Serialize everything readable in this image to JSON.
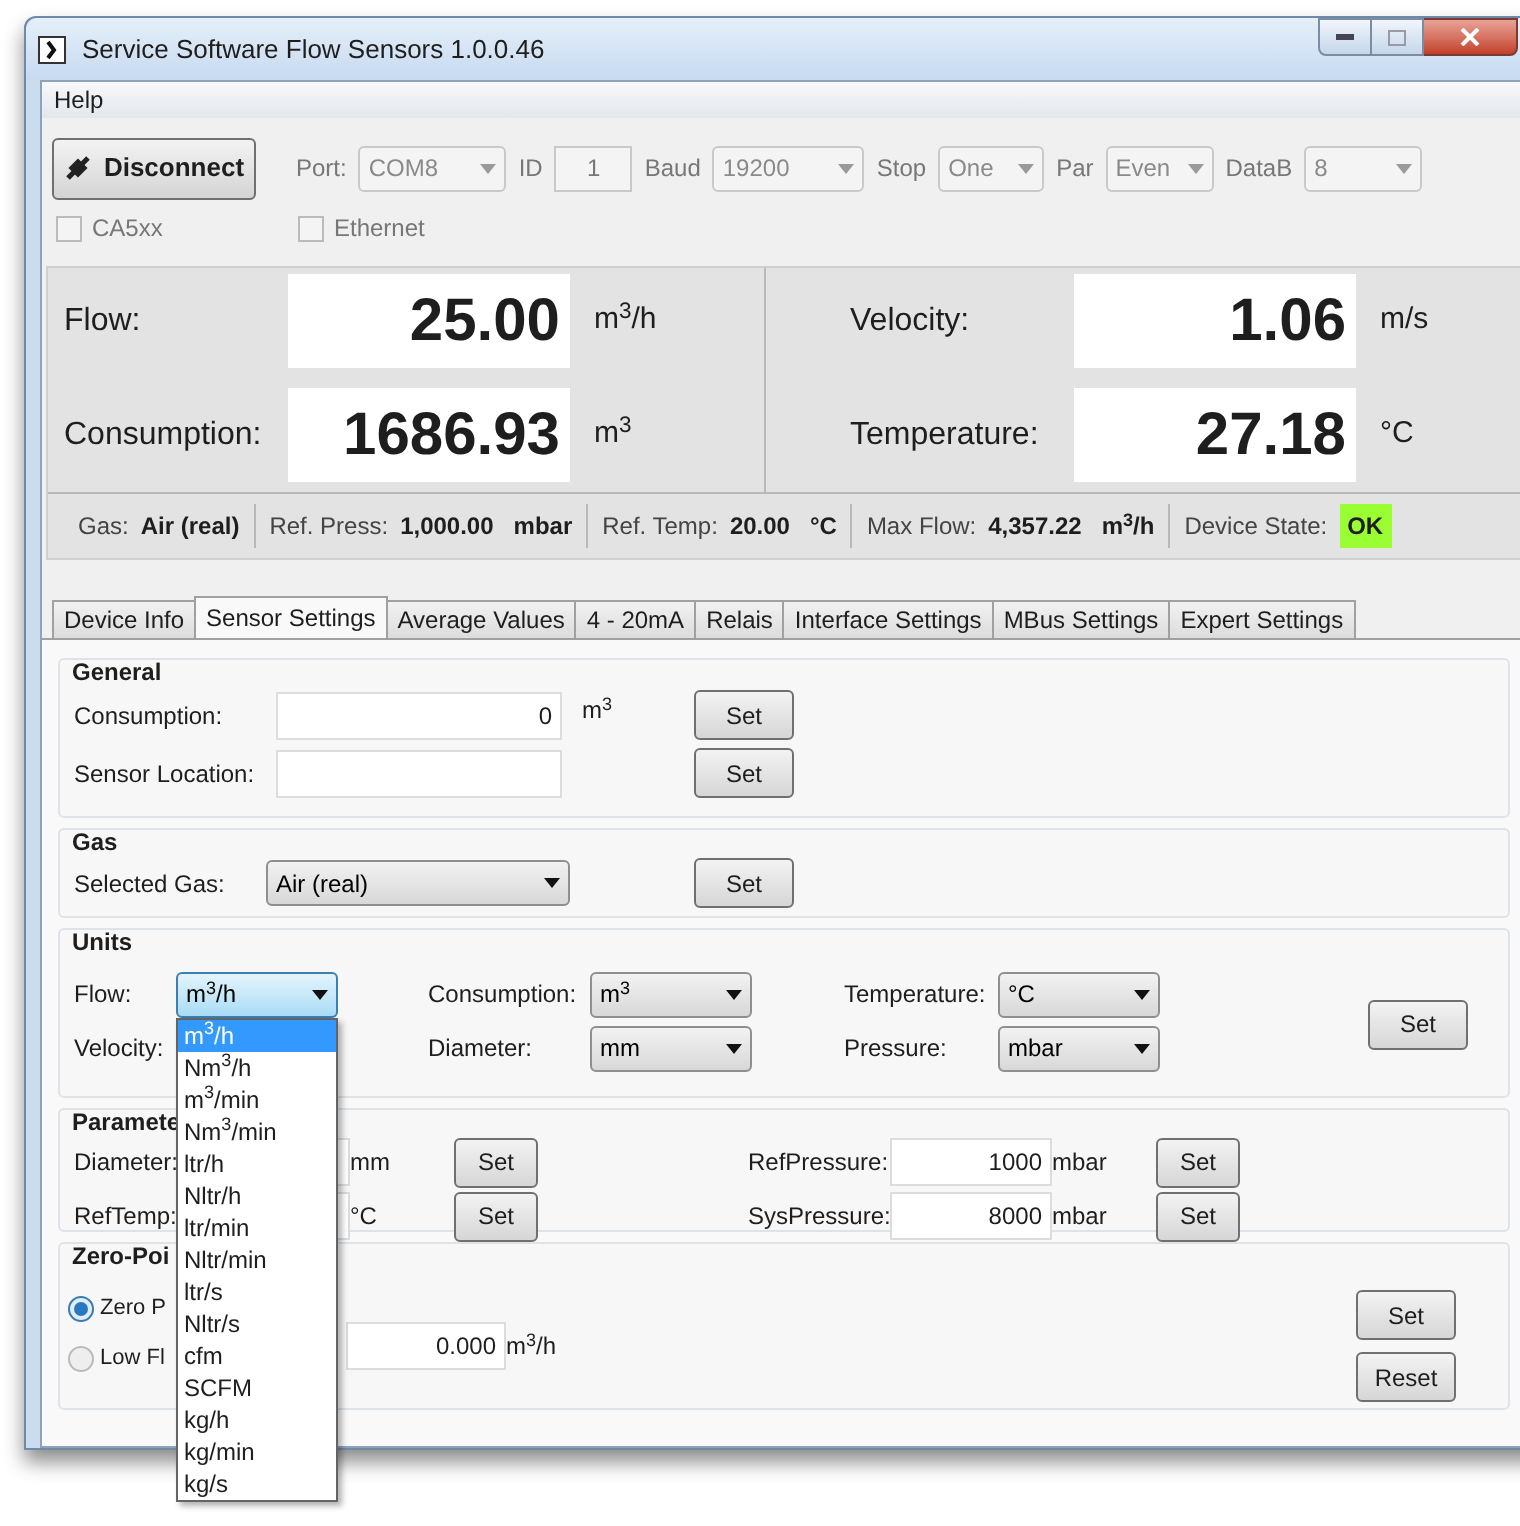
{
  "window": {
    "title": "Service Software Flow Sensors 1.0.0.46"
  },
  "menu": [
    "Help"
  ],
  "connection": {
    "button": "Disconnect",
    "fields": [
      {
        "label": "Port:",
        "value": "COM8",
        "kind": "combo"
      },
      {
        "label": "ID",
        "value": "1",
        "kind": "text"
      },
      {
        "label": "Baud",
        "value": "19200",
        "kind": "combo"
      },
      {
        "label": "Stop",
        "value": "One",
        "kind": "combo"
      },
      {
        "label": "Par",
        "value": "Even",
        "kind": "combo"
      },
      {
        "label": "DataB",
        "value": "8",
        "kind": "combo"
      }
    ],
    "checkboxes": [
      {
        "label": "CA5xx",
        "checked": false
      },
      {
        "label": "Ethernet",
        "checked": false
      }
    ]
  },
  "readings": [
    {
      "label": "Flow:",
      "value": "25.00",
      "unit": "m$^{3}$/h"
    },
    {
      "label": "Velocity:",
      "value": "1.06",
      "unit": "m/s"
    },
    {
      "label": "Consumption:",
      "value": "1686.93",
      "unit": "m$^{3}$"
    },
    {
      "label": "Temperature:",
      "value": "27.18",
      "unit": "°C"
    }
  ],
  "info_bar": [
    {
      "label": "Gas:",
      "value": "Air (real)",
      "kind": "plain"
    },
    {
      "label": "Ref. Press:",
      "value": "1,000.00",
      "unit": "mbar",
      "kind": "plain"
    },
    {
      "label": "Ref. Temp:",
      "value": "20.00",
      "unit": "°C",
      "kind": "plain"
    },
    {
      "label": "Max Flow:",
      "value": "4,357.22",
      "unit": "m$^{3}$/h",
      "kind": "plain"
    },
    {
      "label": "Device State:",
      "value": "OK",
      "kind": "status"
    }
  ],
  "tabs": [
    {
      "label": "Device Info",
      "selected": false
    },
    {
      "label": "Sensor Settings",
      "selected": true
    },
    {
      "label": "Average Values",
      "selected": false
    },
    {
      "label": "4 - 20mA",
      "selected": false
    },
    {
      "label": "Relais",
      "selected": false
    },
    {
      "label": "Interface Settings",
      "selected": false
    },
    {
      "label": "MBus Settings",
      "selected": false
    },
    {
      "label": "Expert Settings",
      "selected": false
    }
  ],
  "general": {
    "title": "General",
    "rows": [
      {
        "label": "Consumption:",
        "value": "0",
        "unit": "m$^{3}$",
        "button": "Set"
      },
      {
        "label": "Sensor Location:",
        "button": "Set"
      }
    ]
  },
  "gas": {
    "title": "Gas",
    "label": "Selected Gas:",
    "value": "Air (real)",
    "button": "Set"
  },
  "units": {
    "title": "Units",
    "fields": [
      {
        "label": "Flow:",
        "value": "m$^{3}$/h",
        "expanded": true
      },
      {
        "label": "Consumption:",
        "value": "m$^{3}$",
        "expanded": false
      },
      {
        "label": "Temperature:",
        "value": "°C",
        "expanded": false
      },
      {
        "label": "Velocity:",
        "expanded": false
      },
      {
        "label": "Diameter:",
        "value": "mm",
        "expanded": false
      },
      {
        "label": "Pressure:",
        "value": "mbar",
        "expanded": false
      }
    ],
    "button": "Set",
    "dropdown_options": [
      {
        "label": "m$^{3}$/h",
        "selected": true
      },
      {
        "label": "Nm$^{3}$/h",
        "selected": false
      },
      {
        "label": "m$^{3}$/min",
        "selected": false
      },
      {
        "label": "Nm$^{3}$/min",
        "selected": false
      },
      {
        "label": "ltr/h",
        "selected": false
      },
      {
        "label": "Nltr/h",
        "selected": false
      },
      {
        "label": "ltr/min",
        "selected": false
      },
      {
        "label": "Nltr/min",
        "selected": false
      },
      {
        "label": "ltr/s",
        "selected": false
      },
      {
        "label": "Nltr/s",
        "selected": false
      },
      {
        "label": "cfm",
        "selected": false
      },
      {
        "label": "SCFM",
        "selected": false
      },
      {
        "label": "kg/h",
        "selected": false
      },
      {
        "label": "kg/min",
        "selected": false
      },
      {
        "label": "kg/s",
        "selected": false
      }
    ]
  },
  "parameters": {
    "title": "Paramete",
    "rows": [
      {
        "label": "Diameter:",
        "unit": "mm",
        "button": "Set"
      },
      {
        "label": "RefPressure:",
        "value": "1000",
        "unit": "mbar",
        "button": "Set"
      },
      {
        "label": "RefTemp:",
        "unit": "°C",
        "button": "Set"
      },
      {
        "label": "SysPressure:",
        "value": "8000",
        "unit": "mbar",
        "button": "Set"
      }
    ]
  },
  "zero_point": {
    "title": "Zero-Poi",
    "options": [
      {
        "label": "Zero P",
        "selected": true
      },
      {
        "label": "Low Fl",
        "selected": false
      }
    ],
    "value": "0.000",
    "unit": "m$^{3}$/h",
    "buttons": [
      "Set",
      "Reset"
    ]
  }
}
